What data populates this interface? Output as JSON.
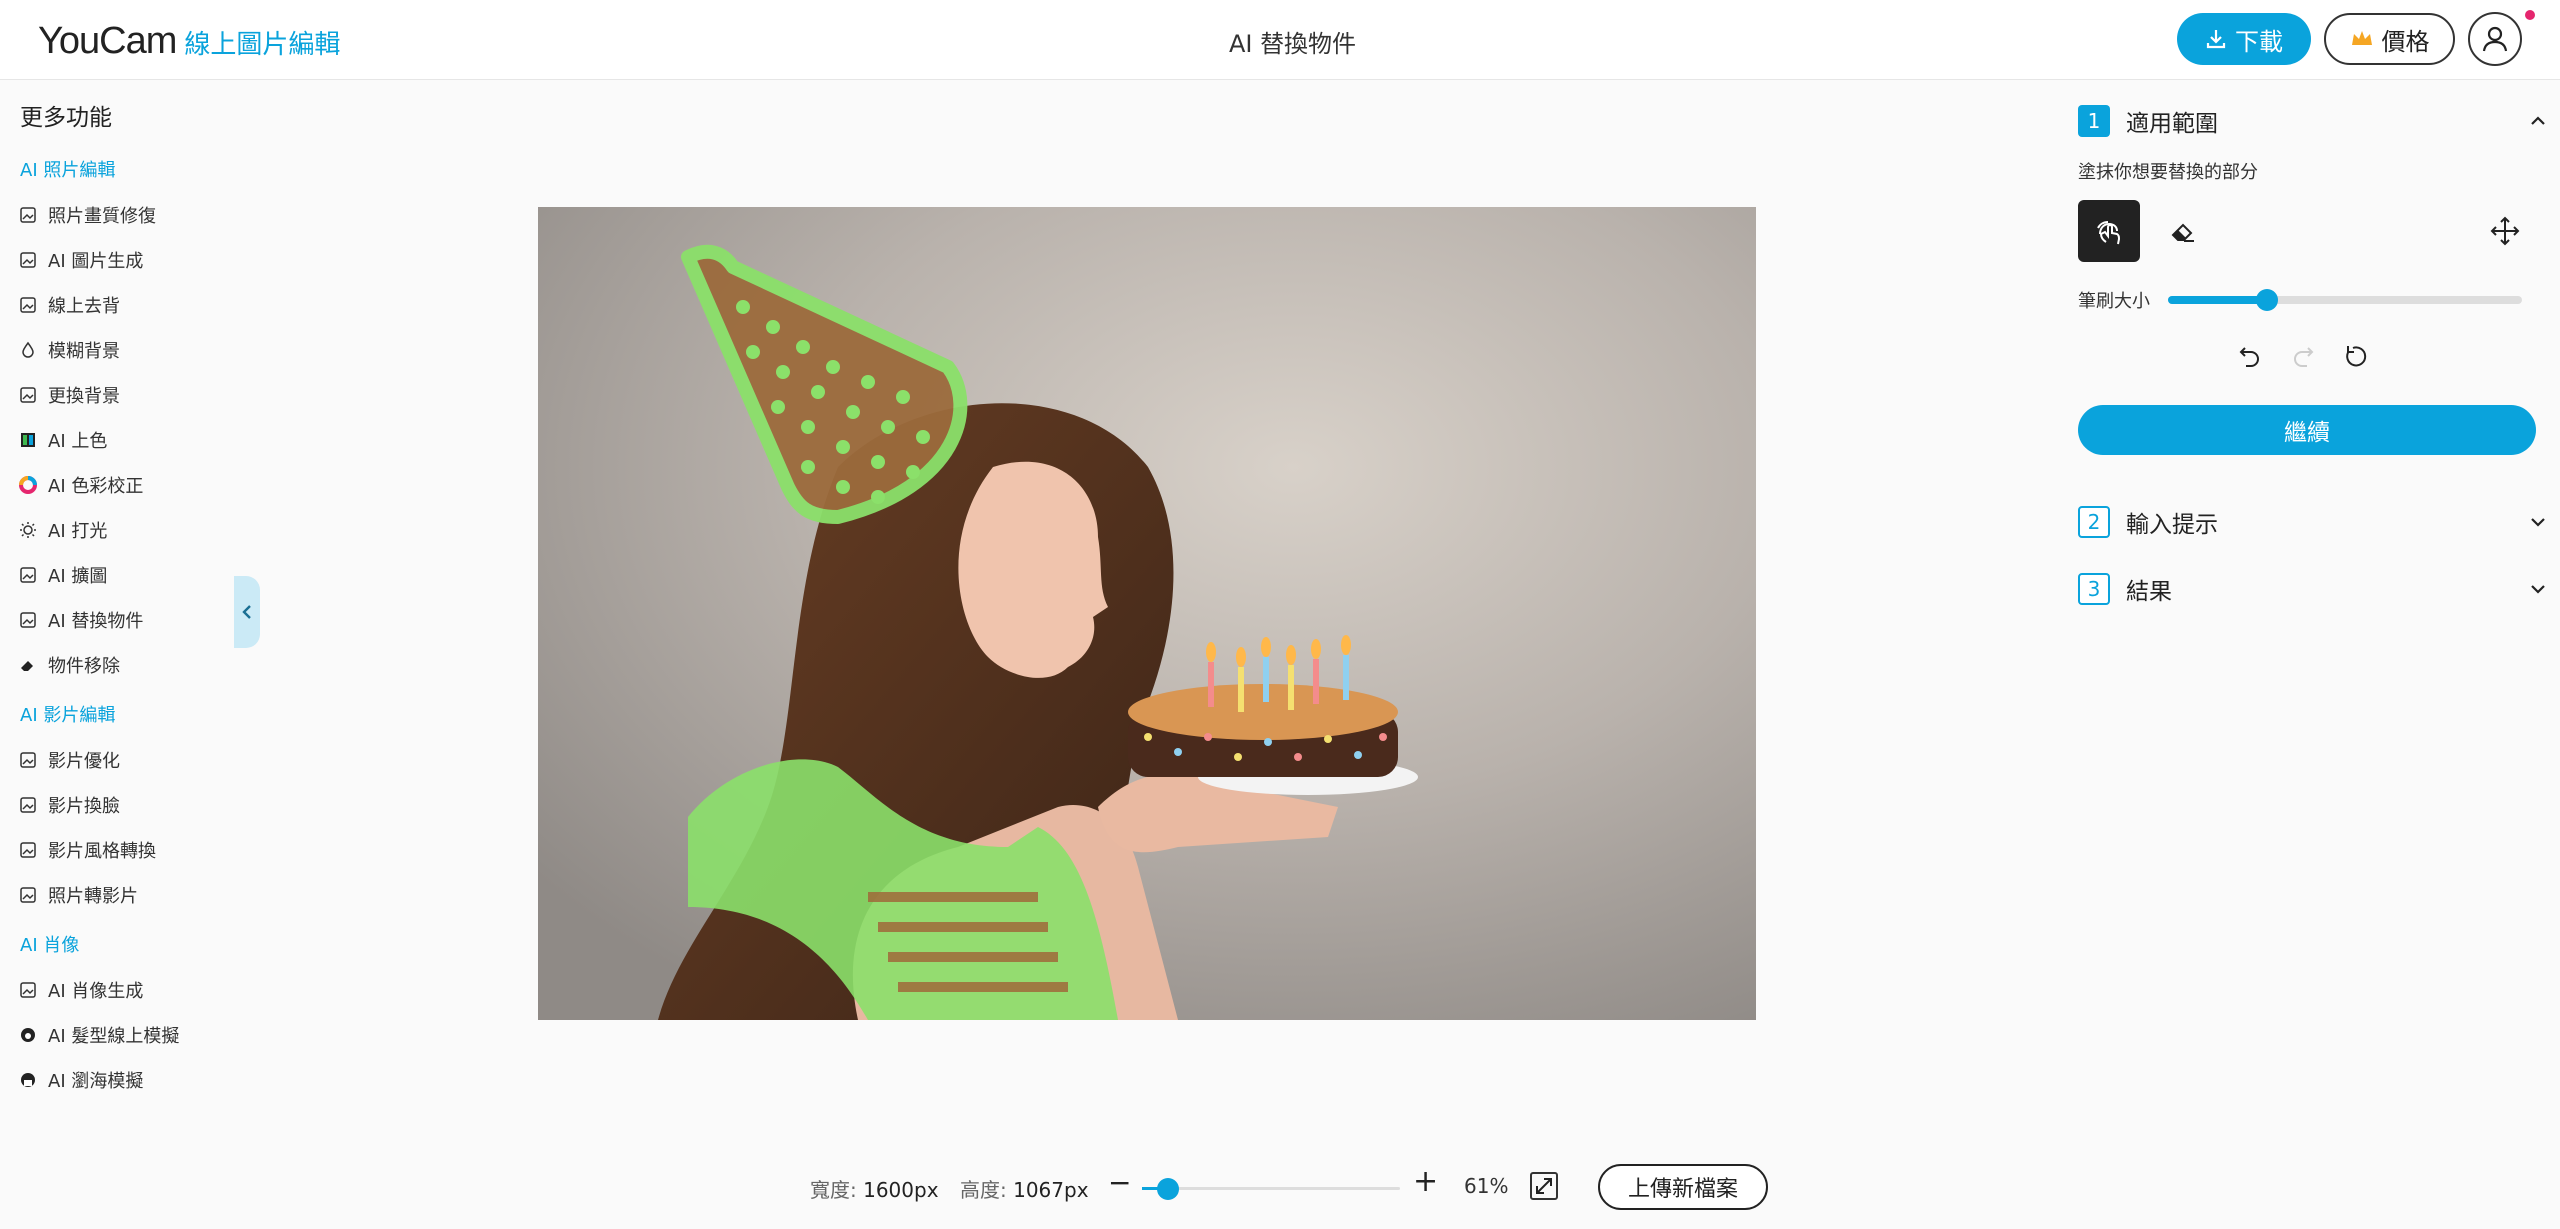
{
  "header": {
    "logo_main": "YouCam",
    "logo_sub": "線上圖片編輯",
    "title": "AI 替換物件",
    "download_label": "下載",
    "price_label": "價格"
  },
  "sidebar": {
    "title": "更多功能",
    "sections": [
      {
        "heading": "AI 照片編輯",
        "items": [
          {
            "label": "照片畫質修復",
            "icon": "photo-enhance-icon"
          },
          {
            "label": "AI 圖片生成",
            "icon": "image-generate-icon"
          },
          {
            "label": "線上去背",
            "icon": "remove-background-icon"
          },
          {
            "label": "模糊背景",
            "icon": "blur-drop-icon"
          },
          {
            "label": "更換背景",
            "icon": "change-background-icon"
          },
          {
            "label": "AI 上色",
            "icon": "colorize-icon"
          },
          {
            "label": "AI 色彩校正",
            "icon": "color-wheel-icon"
          },
          {
            "label": "AI 打光",
            "icon": "light-bulb-icon"
          },
          {
            "label": "AI 擴圖",
            "icon": "expand-icon"
          },
          {
            "label": "AI 替換物件",
            "icon": "replace-object-icon"
          },
          {
            "label": "物件移除",
            "icon": "eraser-icon"
          }
        ]
      },
      {
        "heading": "AI 影片編輯",
        "items": [
          {
            "label": "影片優化",
            "icon": "video-enhance-icon"
          },
          {
            "label": "影片換臉",
            "icon": "face-swap-icon"
          },
          {
            "label": "影片風格轉換",
            "icon": "video-style-icon"
          },
          {
            "label": "照片轉影片",
            "icon": "photo-to-video-icon"
          }
        ]
      },
      {
        "heading": "AI 肖像",
        "items": [
          {
            "label": "AI 肖像生成",
            "icon": "portrait-icon"
          },
          {
            "label": "AI 髮型線上模擬",
            "icon": "hairstyle-icon"
          },
          {
            "label": "AI 瀏海模擬",
            "icon": "bangs-icon"
          }
        ]
      }
    ]
  },
  "canvas": {
    "image_description_icon": "photo-canvas"
  },
  "bottom": {
    "width_label": "寬度:",
    "width_value": "1600px",
    "height_label": "高度:",
    "height_value": "1067px",
    "zoom_value": "61%",
    "zoom_fraction": 0.1,
    "upload_label": "上傳新檔案"
  },
  "panel": {
    "step1": {
      "num": "1",
      "label": "適用範圍"
    },
    "hint": "塗抹你想要替換的部分",
    "brush_label": "筆刷大小",
    "brush_fraction": 0.28,
    "continue_label": "繼續",
    "step2": {
      "num": "2",
      "label": "輸入提示"
    },
    "step3": {
      "num": "3",
      "label": "結果"
    }
  },
  "colors": {
    "accent": "#0aa3dc",
    "mask": "#8be06a",
    "notification": "#e5266e"
  }
}
